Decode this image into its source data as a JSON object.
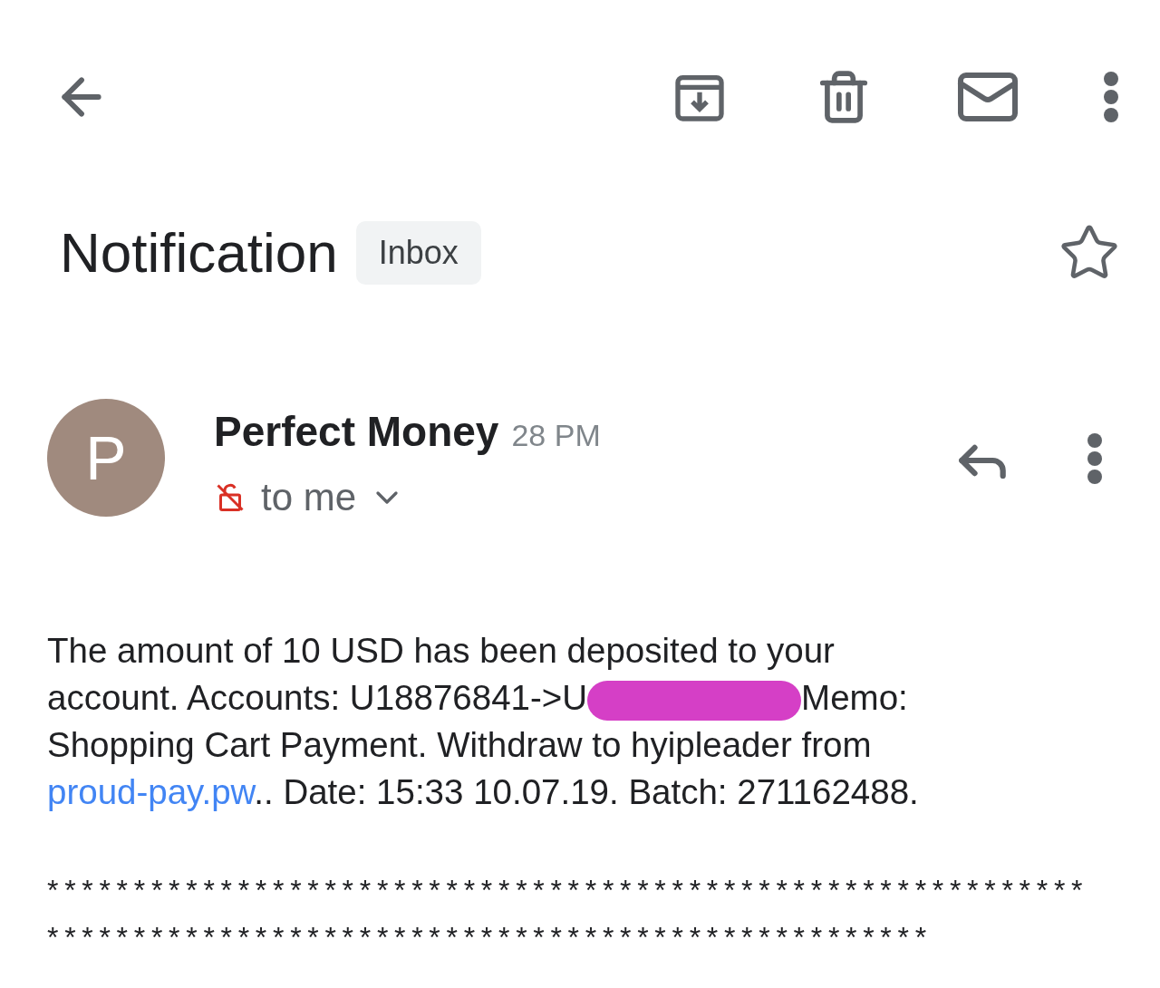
{
  "email": {
    "subject": "Notification",
    "label": "Inbox",
    "starred": false,
    "sender": {
      "initial": "P",
      "name": "Perfect Money",
      "time": "28 PM",
      "recipient": "to me"
    },
    "body": {
      "before": "The amount of 10 USD has been deposited to your account. Accounts: U18876841->U",
      "after": "Memo: Shopping Cart Payment. Withdraw to hyipleader from ",
      "link": "proud-pay.pw",
      "rest": ".. Date: 15:33 10.07.19. Batch: 271162488."
    },
    "separator_lines": [
      "************************************************************",
      "***************************************************"
    ]
  }
}
